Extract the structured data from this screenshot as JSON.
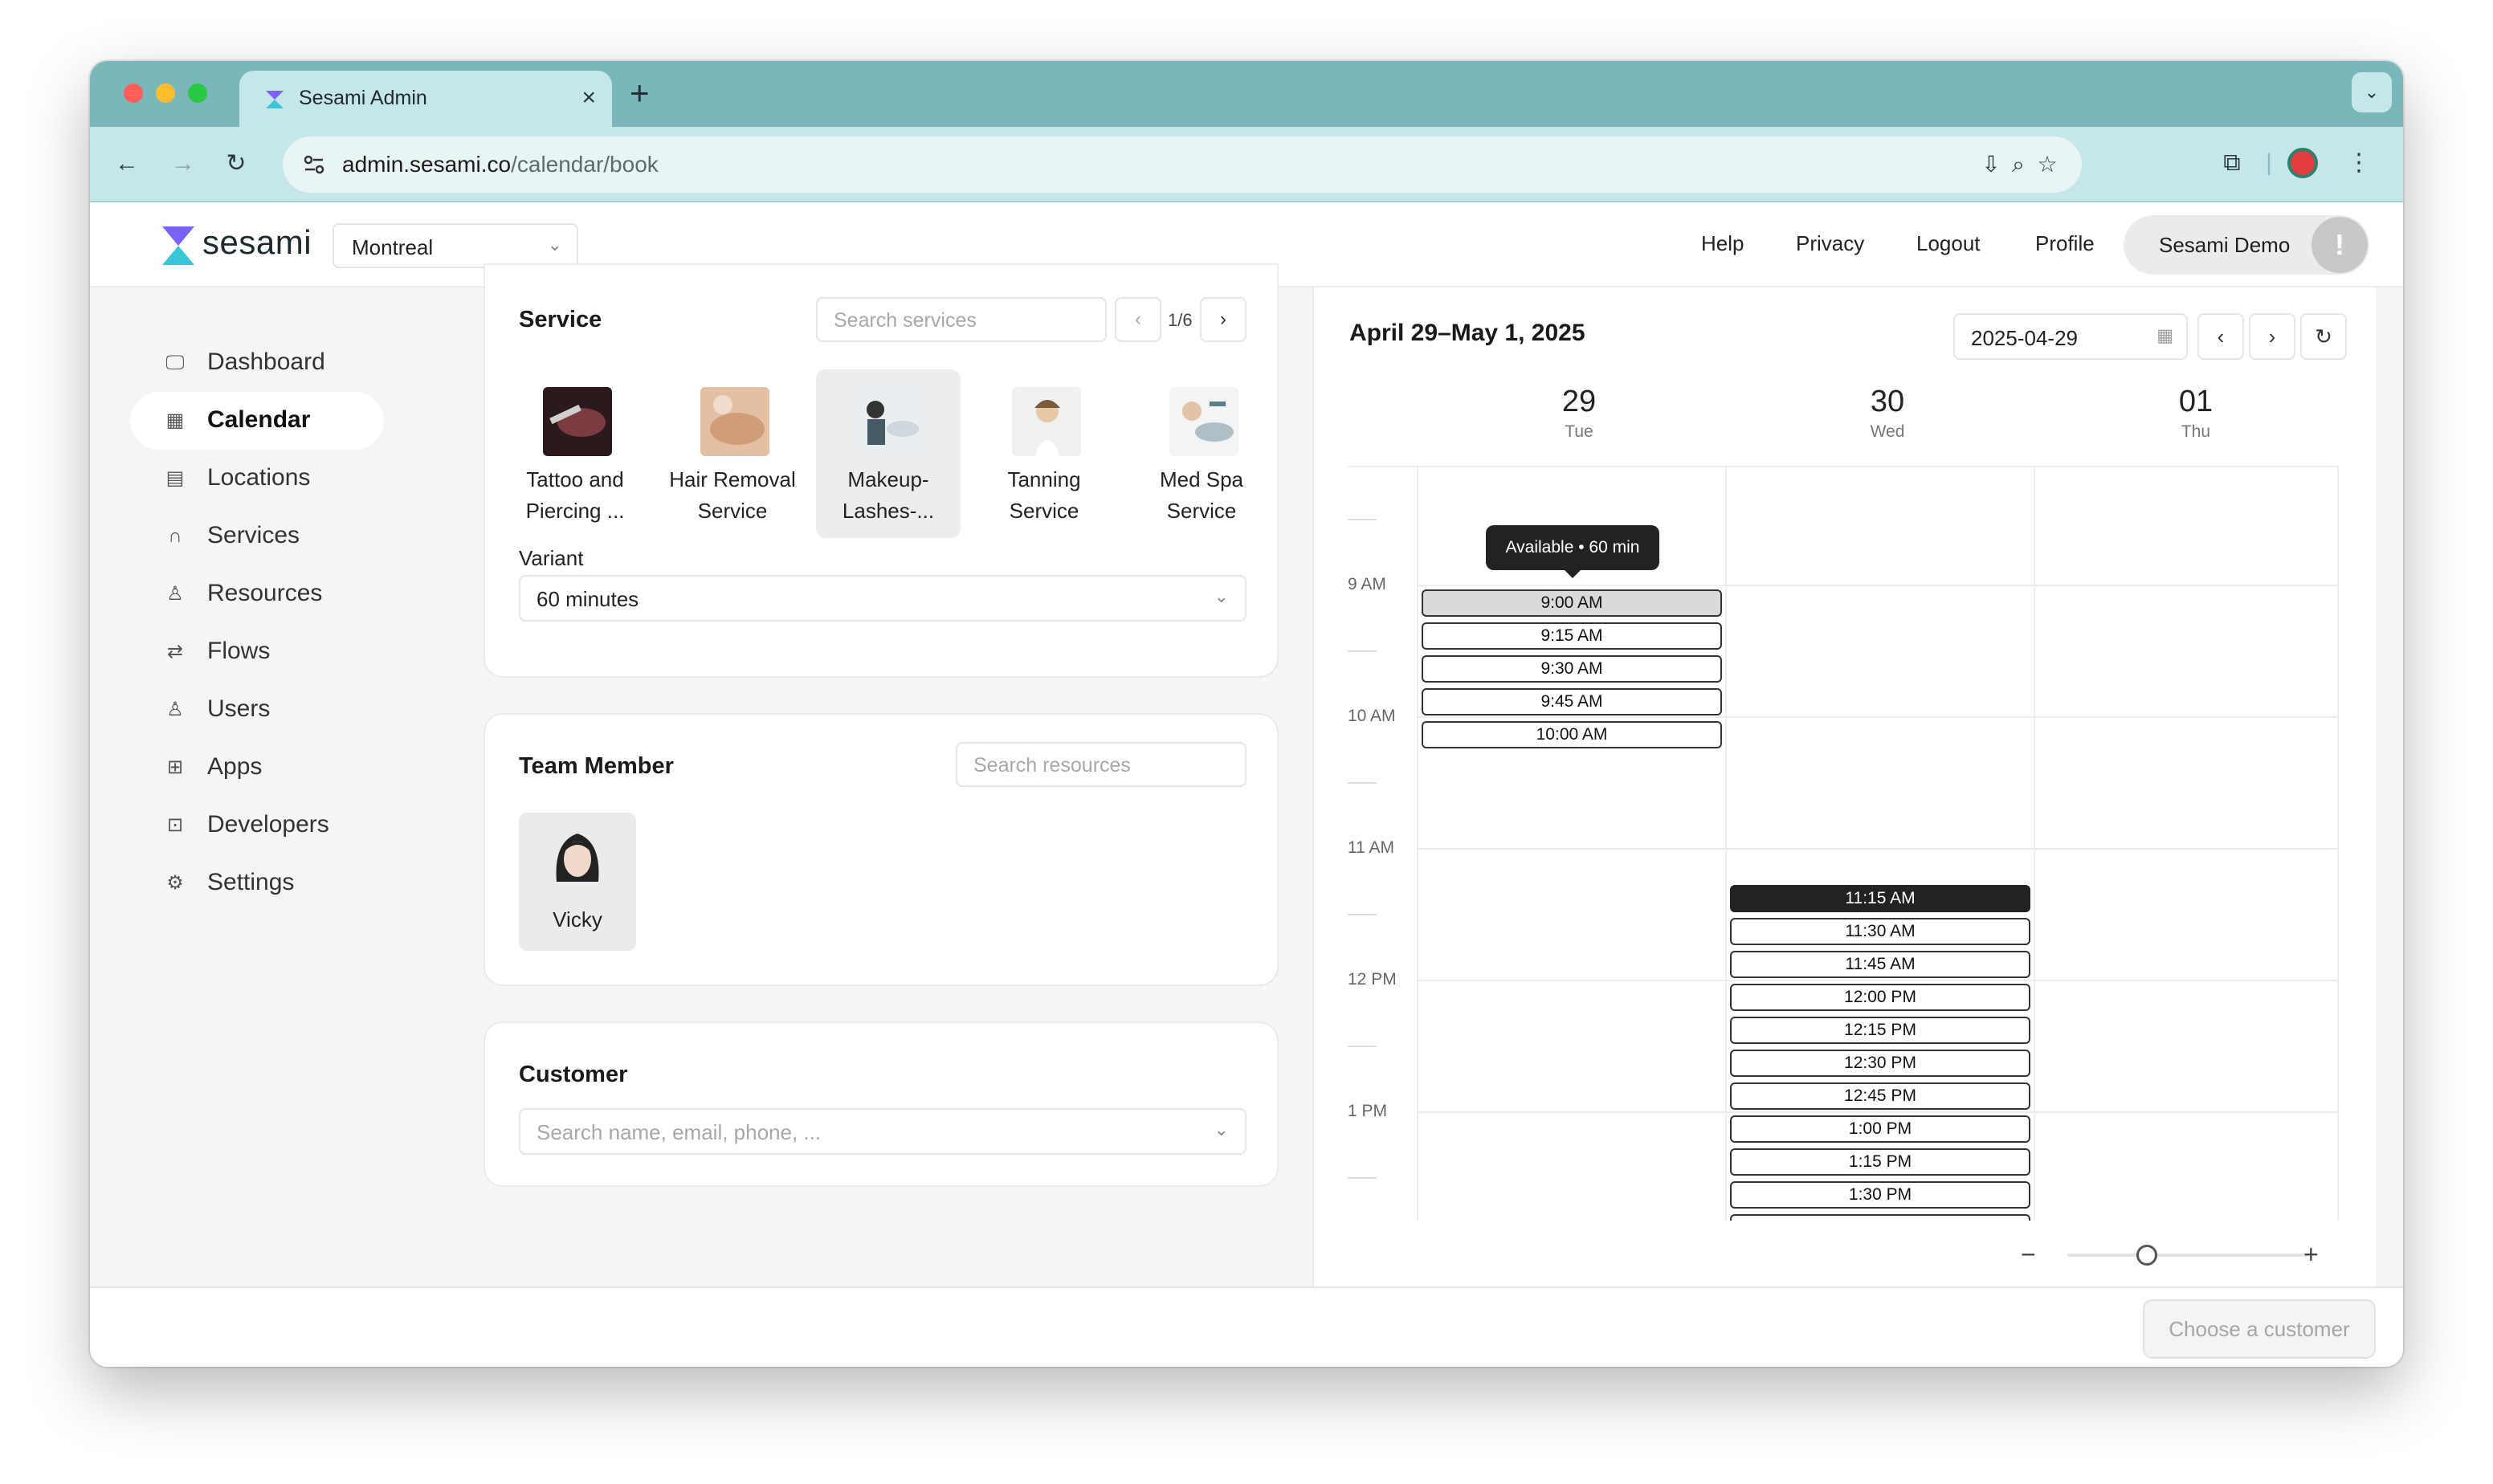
{
  "browser": {
    "tab_title": "Sesami Admin",
    "url_host": "admin.sesami.co",
    "url_path": "/calendar/book",
    "traffic_lights": [
      "#ff5f57",
      "#febc2e",
      "#28c840"
    ]
  },
  "header": {
    "brand": "sesami",
    "location": "Montreal",
    "links": [
      "Help",
      "Privacy",
      "Logout",
      "Profile"
    ],
    "account_name": "Sesami Demo",
    "avatar_text": "!"
  },
  "sidebar": {
    "items": [
      {
        "label": "Dashboard",
        "icon": "monitor-icon"
      },
      {
        "label": "Calendar",
        "icon": "calendar-icon",
        "active": true
      },
      {
        "label": "Locations",
        "icon": "store-icon"
      },
      {
        "label": "Services",
        "icon": "headset-icon"
      },
      {
        "label": "Resources",
        "icon": "people-icon"
      },
      {
        "label": "Flows",
        "icon": "flow-icon"
      },
      {
        "label": "Users",
        "icon": "users-icon"
      },
      {
        "label": "Apps",
        "icon": "apps-icon"
      },
      {
        "label": "Developers",
        "icon": "terminal-icon"
      },
      {
        "label": "Settings",
        "icon": "gear-icon"
      }
    ]
  },
  "service": {
    "title": "Service",
    "search_placeholder": "Search services",
    "page": "1/6",
    "items": [
      {
        "line1": "Tattoo and",
        "line2": "Piercing ..."
      },
      {
        "line1": "Hair Removal",
        "line2": "Service"
      },
      {
        "line1": "Makeup-",
        "line2": "Lashes-...",
        "selected": true
      },
      {
        "line1": "Tanning",
        "line2": "Service"
      },
      {
        "line1": "Med Spa",
        "line2": "Service"
      }
    ],
    "variant_label": "Variant",
    "variant_value": "60 minutes"
  },
  "team": {
    "title": "Team Member",
    "search_placeholder": "Search resources",
    "member_name": "Vicky"
  },
  "customer": {
    "title": "Customer",
    "search_placeholder": "Search name, email, phone, ..."
  },
  "calendar": {
    "range_title": "April 29–May 1, 2025",
    "date_value": "2025-04-29",
    "days": [
      {
        "num": "29",
        "dow": "Tue"
      },
      {
        "num": "30",
        "dow": "Wed"
      },
      {
        "num": "01",
        "dow": "Thu"
      }
    ],
    "hour_labels": [
      "9 AM",
      "10 AM",
      "11 AM",
      "12 PM",
      "1 PM"
    ],
    "tooltip": "Available • 60 min",
    "tue_slots": [
      "9:00 AM",
      "9:15 AM",
      "9:30 AM",
      "9:45 AM",
      "10:00 AM"
    ],
    "wed_slots": [
      "11:15 AM",
      "11:30 AM",
      "11:45 AM",
      "12:00 PM",
      "12:15 PM",
      "12:30 PM",
      "12:45 PM",
      "1:00 PM",
      "1:15 PM",
      "1:30 PM"
    ],
    "zoom_minus": "−",
    "zoom_plus": "+"
  },
  "footer": {
    "action_label": "Choose a customer"
  }
}
